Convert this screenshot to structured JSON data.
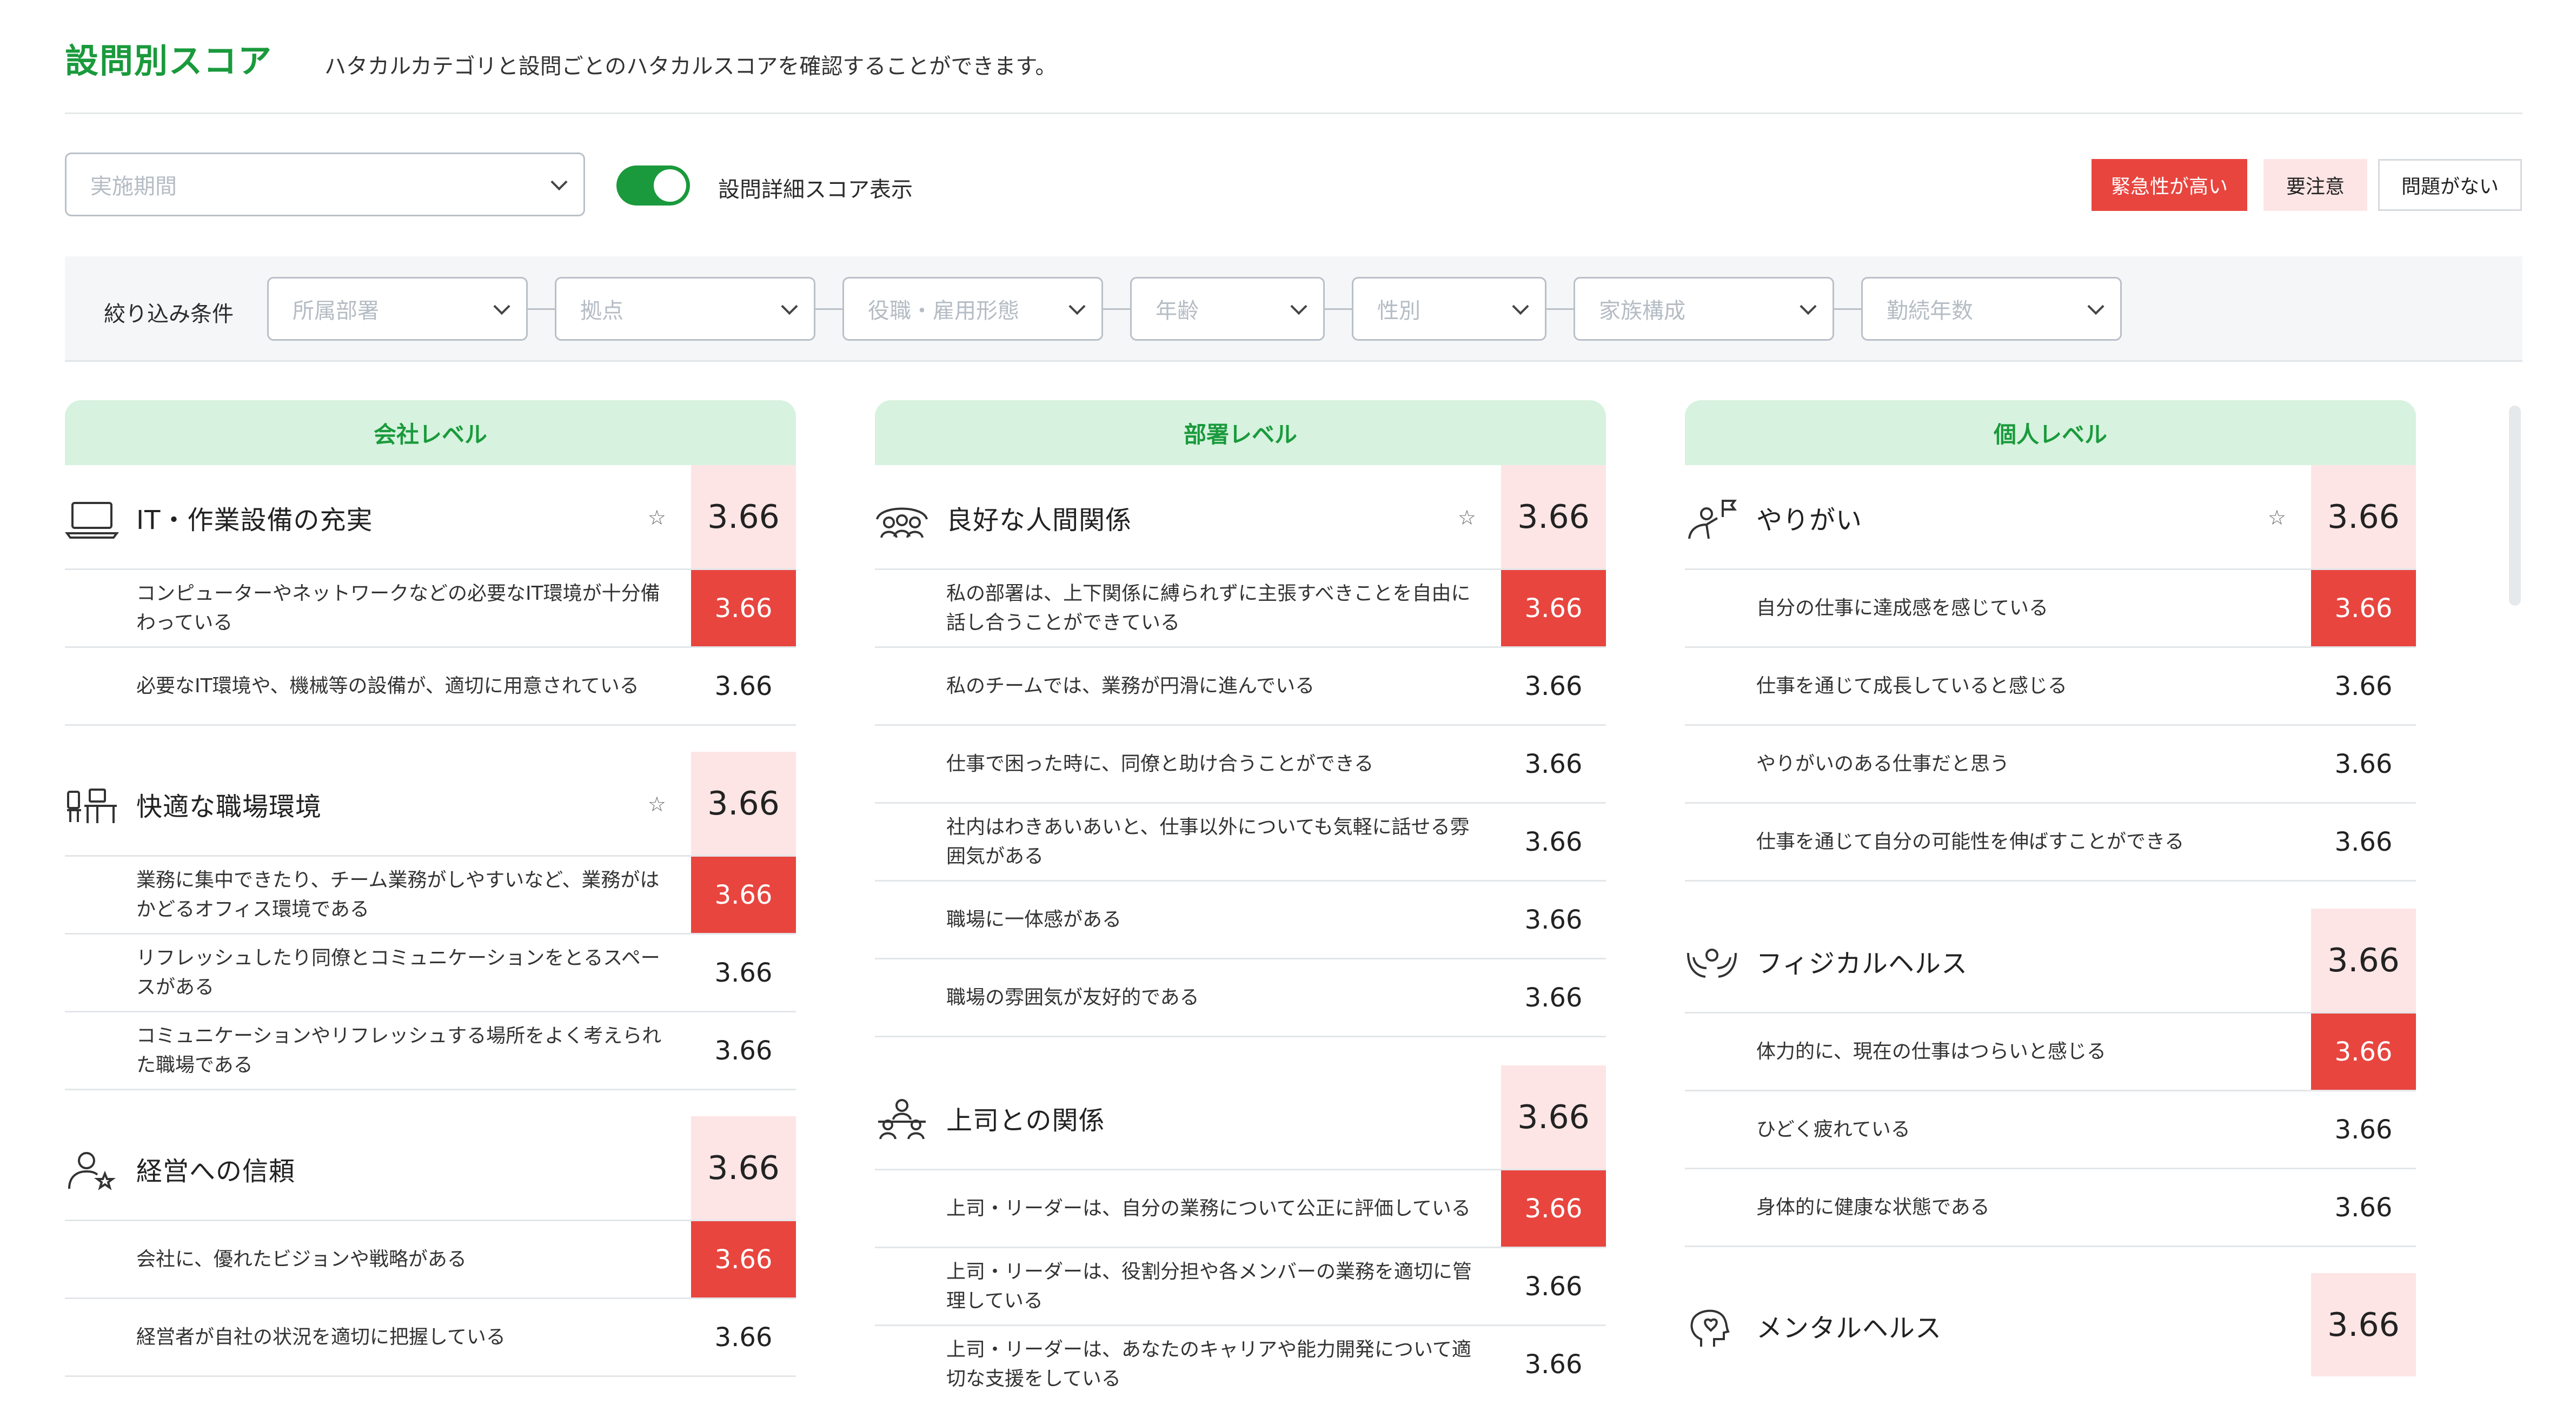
{
  "header": {
    "title": "設問別スコア",
    "subtitle": "ハタカルカテゴリと設問ごとのハタカルスコアを確認することができます。"
  },
  "controls": {
    "period_placeholder": "実施期間",
    "toggle_label": "設問詳細スコア表示",
    "toggle_on": true
  },
  "legend": {
    "urgent": "緊急性が高い",
    "caution": "要注意",
    "ok": "問題がない"
  },
  "filters": {
    "label": "絞り込み条件",
    "items": [
      "所属部署",
      "拠点",
      "役職・雇用形態",
      "年齢",
      "性別",
      "家族構成",
      "勤続年数"
    ]
  },
  "colors": {
    "accent": "#1a9a3c",
    "urgent": "#e8453f",
    "caution": "#fde5e5"
  },
  "columns": [
    {
      "header": "会社レベル",
      "categories": [
        {
          "icon": "laptop-icon",
          "title": "IT・作業設備の充実",
          "star": true,
          "score": "3.66",
          "questions": [
            {
              "text": "コンピューターやネットワークなどの必要なIT環境が十分備わっている",
              "score": "3.66",
              "urgent": true
            },
            {
              "text": "必要なIT環境や、機械等の設備が、適切に用意されている",
              "score": "3.66",
              "urgent": false
            }
          ]
        },
        {
          "icon": "office-desk-icon",
          "title": "快適な職場環境",
          "star": true,
          "score": "3.66",
          "questions": [
            {
              "text": "業務に集中できたり、チーム業務がしやすいなど、業務がはかどるオフィス環境である",
              "score": "3.66",
              "urgent": true
            },
            {
              "text": "リフレッシュしたり同僚とコミュニケーションをとるスペースがある",
              "score": "3.66",
              "urgent": false
            },
            {
              "text": "コミュニケーションやリフレッシュする場所をよく考えられた職場である",
              "score": "3.66",
              "urgent": false
            }
          ]
        },
        {
          "icon": "person-star-icon",
          "title": "経営への信頼",
          "star": false,
          "score": "3.66",
          "questions": [
            {
              "text": "会社に、優れたビジョンや戦略がある",
              "score": "3.66",
              "urgent": true
            },
            {
              "text": "経営者が自社の状況を適切に把握している",
              "score": "3.66",
              "urgent": false
            }
          ]
        }
      ]
    },
    {
      "header": "部署レベル",
      "categories": [
        {
          "icon": "people-group-icon",
          "title": "良好な人間関係",
          "star": true,
          "score": "3.66",
          "questions": [
            {
              "text": "私の部署は、上下関係に縛られずに主張すべきことを自由に話し合うことができている",
              "score": "3.66",
              "urgent": true
            },
            {
              "text": "私のチームでは、業務が円滑に進んでいる",
              "score": "3.66",
              "urgent": false
            },
            {
              "text": "仕事で困った時に、同僚と助け合うことができる",
              "score": "3.66",
              "urgent": false
            },
            {
              "text": "社内はわきあいあいと、仕事以外についても気軽に話せる雰囲気がある",
              "score": "3.66",
              "urgent": false
            },
            {
              "text": "職場に一体感がある",
              "score": "3.66",
              "urgent": false
            },
            {
              "text": "職場の雰囲気が友好的である",
              "score": "3.66",
              "urgent": false
            }
          ]
        },
        {
          "icon": "boss-team-icon",
          "title": "上司との関係",
          "star": false,
          "score": "3.66",
          "questions": [
            {
              "text": "上司・リーダーは、自分の業務について公正に評価している",
              "score": "3.66",
              "urgent": true
            },
            {
              "text": "上司・リーダーは、役割分担や各メンバーの業務を適切に管理している",
              "score": "3.66",
              "urgent": false
            },
            {
              "text": "上司・リーダーは、あなたのキャリアや能力開発について適切な支援をしている",
              "score": "3.66",
              "urgent": false
            }
          ]
        }
      ]
    },
    {
      "header": "個人レベル",
      "categories": [
        {
          "icon": "person-flag-icon",
          "title": "やりがい",
          "star": true,
          "score": "3.66",
          "questions": [
            {
              "text": "自分の仕事に達成感を感じている",
              "score": "3.66",
              "urgent": true
            },
            {
              "text": "仕事を通じて成長していると感じる",
              "score": "3.66",
              "urgent": false
            },
            {
              "text": "やりがいのある仕事だと思う",
              "score": "3.66",
              "urgent": false
            },
            {
              "text": "仕事を通じて自分の可能性を伸ばすことができる",
              "score": "3.66",
              "urgent": false
            }
          ]
        },
        {
          "icon": "hands-care-icon",
          "title": "フィジカルヘルス",
          "star": false,
          "score": "3.66",
          "questions": [
            {
              "text": "体力的に、現在の仕事はつらいと感じる",
              "score": "3.66",
              "urgent": true
            },
            {
              "text": "ひどく疲れている",
              "score": "3.66",
              "urgent": false
            },
            {
              "text": "身体的に健康な状態である",
              "score": "3.66",
              "urgent": false
            }
          ]
        },
        {
          "icon": "head-heart-icon",
          "title": "メンタルヘルス",
          "star": false,
          "score": "3.66",
          "questions": []
        }
      ]
    }
  ]
}
